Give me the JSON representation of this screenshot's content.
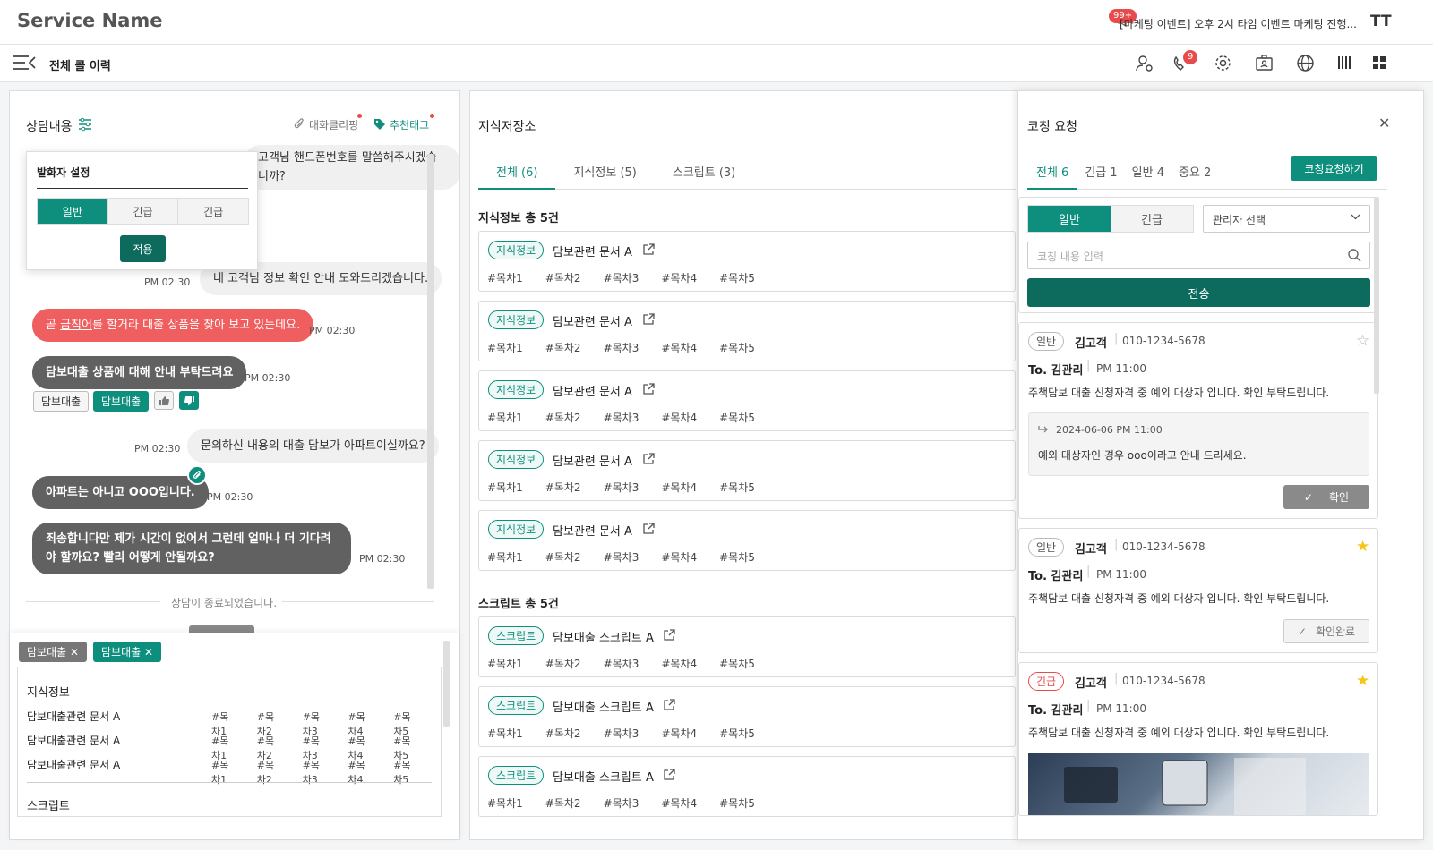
{
  "header": {
    "service_name": "Service Name",
    "notice_badge": "99+",
    "notice_text": "[마케팅 이벤트] 오후 2시 타임 이벤트 마케팅 진행...",
    "font_size_label": "TT"
  },
  "nav": {
    "page_title": "전체 콜 이력",
    "call_badge": "9"
  },
  "consult": {
    "title": "상담내용",
    "clipping_label": "대화클리핑",
    "tags_label": "추천태그",
    "speaker_popup": {
      "title": "발화자 설정",
      "options": [
        "일반",
        "긴급",
        "긴급"
      ],
      "apply_label": "적용"
    },
    "messages": [
      {
        "text": "고객님 핸드폰번호를 말씀해주시겠습니까?",
        "time": ""
      },
      {
        "text": "네 고객님 정보 확인 안내 도와드리겠습니다.",
        "time": "PM 02:30"
      },
      {
        "text_a": "곧 ",
        "text_b": "금칙어",
        "text_c": "를 할거라 대출 상품을 찾아 보고 있는데요.",
        "time": "PM 02:30"
      },
      {
        "text": "담보대출 상품에 대해 안내 부탁드려요",
        "time": "PM 02:30"
      },
      {
        "text": "문의하신 내용의 대출 담보가 아파트이실까요?",
        "time": "PM 02:30"
      },
      {
        "text": "아파트는 아니고 OOO입니다.",
        "time": "PM 02:30"
      },
      {
        "text": "죄송합니다만 제가 시간이 없어서 그런데 얼마나 더 기다려야 할까요? 빨리 어떻게 안될까요?",
        "time": "PM 02:30"
      }
    ],
    "msg_tags": [
      "담보대출",
      "담보대출"
    ],
    "ended_label": "상담이 종료되었습니다.",
    "filter_tags": [
      "담보대출",
      "담보대출"
    ],
    "kb_section_title": "지식정보",
    "kb_rows": [
      {
        "title": "담보대출관련 문서 A",
        "tocs": [
          "#목차1",
          "#목차2",
          "#목차3",
          "#목차4",
          "#목차5"
        ]
      },
      {
        "title": "담보대출관련 문서 A",
        "tocs": [
          "#목차1",
          "#목차2",
          "#목차3",
          "#목차4",
          "#목차5"
        ]
      },
      {
        "title": "담보대출관련 문서 A",
        "tocs": [
          "#목차1",
          "#목차2",
          "#목차3",
          "#목차4",
          "#목차5"
        ]
      }
    ],
    "script_section_title": "스크립트"
  },
  "kb": {
    "title": "지식저장소",
    "tabs": [
      "전체 (6)",
      "지식정보 (5)",
      "스크립트 (3)"
    ],
    "info_total": "지식정보 총 5건",
    "info_items": [
      {
        "type": "지식정보",
        "title": "담보관련 문서 A",
        "tocs": [
          "#목차1",
          "#목차2",
          "#목차3",
          "#목차4",
          "#목차5"
        ]
      },
      {
        "type": "지식정보",
        "title": "담보관련 문서 A",
        "tocs": [
          "#목차1",
          "#목차2",
          "#목차3",
          "#목차4",
          "#목차5"
        ]
      },
      {
        "type": "지식정보",
        "title": "담보관련 문서 A",
        "tocs": [
          "#목차1",
          "#목차2",
          "#목차3",
          "#목차4",
          "#목차5"
        ]
      },
      {
        "type": "지식정보",
        "title": "담보관련 문서 A",
        "tocs": [
          "#목차1",
          "#목차2",
          "#목차3",
          "#목차4",
          "#목차5"
        ]
      },
      {
        "type": "지식정보",
        "title": "담보관련 문서 A",
        "tocs": [
          "#목차1",
          "#목차2",
          "#목차3",
          "#목차4",
          "#목차5"
        ]
      }
    ],
    "script_total": "스크립트 총 5건",
    "script_items": [
      {
        "type": "스크립트",
        "title": "담보대출 스크립트 A",
        "tocs": [
          "#목차1",
          "#목차2",
          "#목차3",
          "#목차4",
          "#목차5"
        ]
      },
      {
        "type": "스크립트",
        "title": "담보대출 스크립트 A",
        "tocs": [
          "#목차1",
          "#목차2",
          "#목차3",
          "#목차4",
          "#목차5"
        ]
      },
      {
        "type": "스크립트",
        "title": "담보대출 스크립트 A",
        "tocs": [
          "#목차1",
          "#목차2",
          "#목차3",
          "#목차4",
          "#목차5"
        ]
      }
    ]
  },
  "coaching": {
    "title": "코칭 요청",
    "tabs": [
      "전체 6",
      "긴급 1",
      "일반 4",
      "중요 2"
    ],
    "request_button": "코칭요청하기",
    "type_options": [
      "일반",
      "긴급"
    ],
    "manager_select": "관리자 선택",
    "input_placeholder": "코칭 내용 입력",
    "send_label": "전송",
    "cards": [
      {
        "level": "일반",
        "name": "김고객",
        "phone": "010-1234-5678",
        "to": "To. 김관리",
        "time": "PM 11:00",
        "body": "주책담보 대출 신청자격 중 예외 대상자 입니다. 확인 부탁드립니다.",
        "reply_date": "2024-06-06 PM 11:00",
        "reply_text": "예외 대상자인 경우 ooo이라고 안내 드리세요.",
        "action": "확인",
        "starred": false
      },
      {
        "level": "일반",
        "name": "김고객",
        "phone": "010-1234-5678",
        "to": "To. 김관리",
        "time": "PM 11:00",
        "body": "주책담보 대출 신청자격 중 예외 대상자 입니다. 확인 부탁드립니다.",
        "action": "확인완료",
        "starred": true
      },
      {
        "level": "긴급",
        "name": "김고객",
        "phone": "010-1234-5678",
        "to": "To. 김관리",
        "time": "PM 11:00",
        "body": "주책담보 대출 신청자격 중 예외 대상자 입니다. 확인 부탁드립니다.",
        "starred": true
      }
    ]
  },
  "colors": {
    "accent": "#0e8f7e",
    "dark_accent": "#0d6b5e",
    "alert": "#e84b4b",
    "bubble_dark": "#616161",
    "star": "#f5c518"
  }
}
